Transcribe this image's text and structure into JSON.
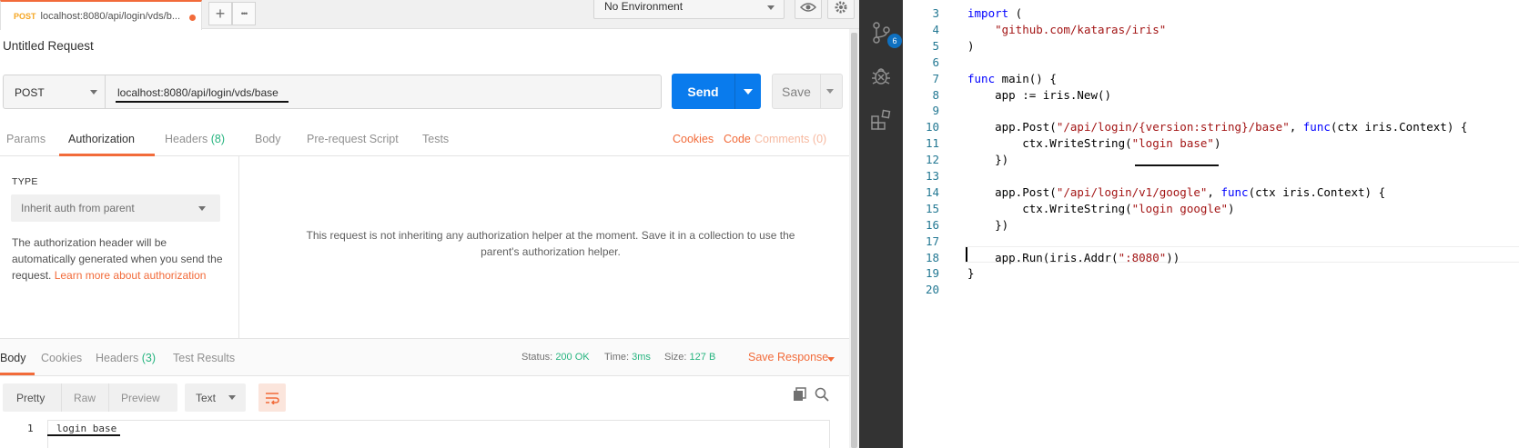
{
  "tab": {
    "method": "POST",
    "url": "localhost:8080/api/login/vds/b..."
  },
  "topbar": {
    "add_symbol": "+",
    "more_symbol": "•••",
    "environment": "No Environment"
  },
  "request": {
    "title": "Untitled Request",
    "method": "POST",
    "url": "localhost:8080/api/login/vds/base",
    "send_label": "Send",
    "save_label": "Save"
  },
  "req_tabs": {
    "params": "Params",
    "authorization": "Authorization",
    "headers": "Headers",
    "headers_count": "(8)",
    "body": "Body",
    "prerequest": "Pre-request Script",
    "tests": "Tests",
    "cookies": "Cookies",
    "code": "Code",
    "comments": "Comments (0)"
  },
  "auth": {
    "type_label": "TYPE",
    "type_value": "Inherit auth from parent",
    "desc": "The authorization header will be automatically generated when you send the request. ",
    "learn_more": "Learn more about authorization",
    "message_1": "This request is not inheriting any authorization helper at the moment. Save it in a collection to use the",
    "message_2": "parent's authorization helper."
  },
  "response": {
    "tabs": {
      "body": "Body",
      "cookies": "Cookies",
      "headers": "Headers",
      "headers_count": "(3)",
      "test_results": "Test Results"
    },
    "status_label": "Status:",
    "status_value": "200 OK",
    "time_label": "Time:",
    "time_value": "3ms",
    "size_label": "Size:",
    "size_value": "127 B",
    "save_response": "Save Response",
    "formats": {
      "pretty": "Pretty",
      "raw": "Raw",
      "preview": "Preview",
      "text": "Text"
    },
    "line_number": "1",
    "body_text": "login base"
  },
  "activity": {
    "badge": "6"
  },
  "editor": {
    "lines": [
      {
        "n": "3",
        "segs": [
          {
            "t": "import",
            "c": "kw"
          },
          {
            "t": " (",
            "c": ""
          }
        ]
      },
      {
        "n": "4",
        "segs": [
          {
            "t": "    ",
            "c": ""
          },
          {
            "t": "\"github.com/kataras/iris\"",
            "c": "str"
          }
        ]
      },
      {
        "n": "5",
        "segs": [
          {
            "t": ")",
            "c": ""
          }
        ]
      },
      {
        "n": "6",
        "segs": []
      },
      {
        "n": "7",
        "segs": [
          {
            "t": "func",
            "c": "kw"
          },
          {
            "t": " main() {",
            "c": ""
          }
        ]
      },
      {
        "n": "8",
        "segs": [
          {
            "t": "    app := iris.New()",
            "c": ""
          }
        ]
      },
      {
        "n": "9",
        "segs": []
      },
      {
        "n": "10",
        "segs": [
          {
            "t": "    app.Post(",
            "c": ""
          },
          {
            "t": "\"/api/login/{version:string}/base\"",
            "c": "str"
          },
          {
            "t": ", ",
            "c": ""
          },
          {
            "t": "func",
            "c": "kw"
          },
          {
            "t": "(ctx iris.Context) {",
            "c": ""
          }
        ]
      },
      {
        "n": "11",
        "segs": [
          {
            "t": "        ctx.WriteString(",
            "c": ""
          },
          {
            "t": "\"login base\"",
            "c": "str"
          },
          {
            "t": ")",
            "c": ""
          }
        ]
      },
      {
        "n": "12",
        "segs": [
          {
            "t": "    })",
            "c": ""
          }
        ]
      },
      {
        "n": "13",
        "segs": []
      },
      {
        "n": "14",
        "segs": [
          {
            "t": "    app.Post(",
            "c": ""
          },
          {
            "t": "\"/api/login/v1/google\"",
            "c": "str"
          },
          {
            "t": ", ",
            "c": ""
          },
          {
            "t": "func",
            "c": "kw"
          },
          {
            "t": "(ctx iris.Context) {",
            "c": ""
          }
        ]
      },
      {
        "n": "15",
        "segs": [
          {
            "t": "        ctx.WriteString(",
            "c": ""
          },
          {
            "t": "\"login google\"",
            "c": "str"
          },
          {
            "t": ")",
            "c": ""
          }
        ]
      },
      {
        "n": "16",
        "segs": [
          {
            "t": "    })",
            "c": ""
          }
        ]
      },
      {
        "n": "17",
        "segs": []
      },
      {
        "n": "18",
        "segs": [
          {
            "t": "    app.Run(iris.Addr(",
            "c": ""
          },
          {
            "t": "\":8080\"",
            "c": "str"
          },
          {
            "t": "))",
            "c": ""
          }
        ]
      },
      {
        "n": "19",
        "segs": [
          {
            "t": "}",
            "c": ""
          }
        ]
      },
      {
        "n": "20",
        "segs": []
      }
    ]
  },
  "colors": {
    "accent": "#f26b3a",
    "send": "#097bed",
    "success": "#26b47f",
    "keyword": "#0000ff",
    "string": "#a31515",
    "line_number": "#237893"
  }
}
